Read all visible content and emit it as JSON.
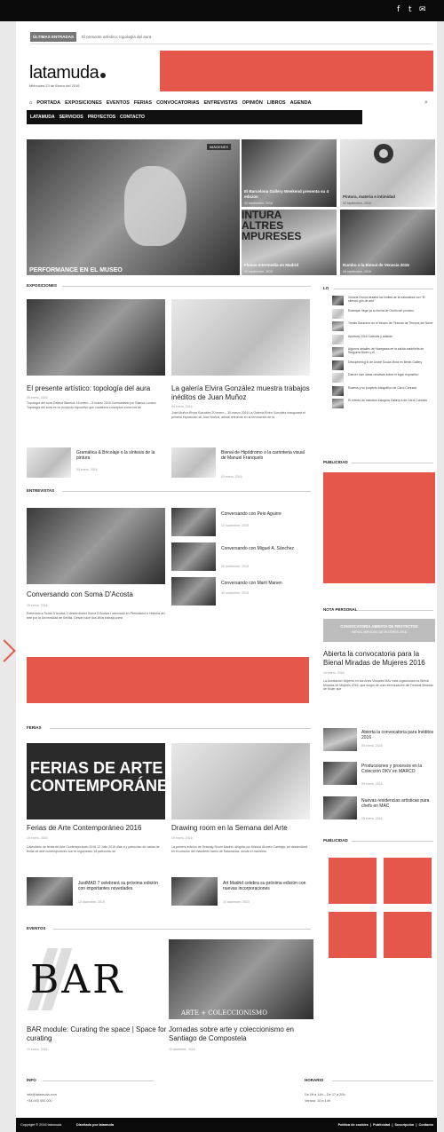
{
  "social": {
    "facebook": "f",
    "twitter": "t",
    "email": "✉"
  },
  "ticker": {
    "tag": "ÚLTIMAS ENTRADAS",
    "text": "El presente artístico: topología del aura"
  },
  "site": {
    "logo": "latamuda",
    "date": "Miércoles 23 de Enero del 2016"
  },
  "nav": {
    "primary": [
      "PORTADA",
      "EXPOSICIONES",
      "EVENTOS",
      "FERIAS",
      "CONVOCATORIAS",
      "ENTREVISTAS",
      "OPINIÓN",
      "LIBROS",
      "AGENDA"
    ],
    "secondary": [
      "LATAMUDA",
      "SERVICIOS",
      "PROYECTOS",
      "CONTACTO"
    ]
  },
  "hero": {
    "main": {
      "badge": "IMÁGENES",
      "caption": "PERFORMANCE EN EL MUSEO"
    },
    "tiles": [
      {
        "title": "El Barcelona Gallery Weekend presenta su 4 edición",
        "date": "30 septiembre, 2016"
      },
      {
        "title": "Fluxus Intermedia en Madrid",
        "date": "09 septiembre, 2016"
      },
      {
        "title": "Pintura, materia e intimidad",
        "date": "02 septiembre, 2016"
      },
      {
        "title": "Rumbo a la Bienal de Venecia 2015",
        "date": "06 septiembre, 2016"
      }
    ],
    "pintura_text": "INTURA\nALTRES\nMPURESES"
  },
  "sections": {
    "exposiciones": "EXPOSICIONES",
    "entrevistas": "ENTREVISTAS",
    "ferias": "FERIAS",
    "eventos": "EVENTOS"
  },
  "expo": {
    "a1": {
      "title": "El presente artístico: topología del aura",
      "date": "05 enero, 2016",
      "text": "Topología del aura Galería Bacelos 15 enero – 5 marzo 2016 Comisariado por Blanca Lozano. Topología del aura es un proyecto expositivo que cuestiona conceptos como los de"
    },
    "a2": {
      "title": "La galería Elvira González muestra trabajos inéditos de Juan Muñoz",
      "date": "04 enero, 2016",
      "text": "Juan Muñoz Elvira González 20 enero – 30 marzo 2016 La Galería Elvira González inaugurará el primera exposición de Juan Muñoz, artista referente en la renovación de la"
    },
    "s1": {
      "title": "Gramática & Bricolaje o la síntesis de la pintura",
      "date": "03 enero, 2016"
    },
    "s2": {
      "title": "Bienal de Hipódromo o la carrinteria visual de Manuel Franquelo",
      "date": "02 enero, 2016"
    }
  },
  "sidebar_list": {
    "title": "LO",
    "items": [
      "Victoria Civera desafía los límites de la naturaleza con \"El silencio gris de arte\"",
      "Estampa: llega ya su fecha de Otoño del próximo",
      "Tomás Saraceno en el Museo de Pinturas de Tempus del Norte",
      "Apertura 2016 Galerías y artistas",
      "Algunos detalles de Hasegawa en la salida madrileña de Rieguera Divert y el",
      "Desciphering lo de André Souza Mora en Berlin Gallery",
      "Dancer com ideas creativas sobre el lugar expositivo",
      "Rodeos y su proyecto fotográfico de Carol Conrado",
      "El evento de metodos inaugura Gallery a de Carol Conrado"
    ]
  },
  "publicidad": "PUBLICIDAD",
  "entrevistas": {
    "main": {
      "title": "Conversando con Soma D'Acosta",
      "date": "15 enero, 2016",
      "text": "Entrevista a Soma D'Acosta Y desarrollador Soma D'Acosta Licenciado en Periodismo e Historia del arte por la Universidad de Sevilla. Desde hace dos años trabaja como"
    },
    "items": [
      {
        "title": "Conversando con Peio Aguirre",
        "date": "12 noviembre, 2015"
      },
      {
        "title": "Conversando con Miguel A. Sánchez",
        "date": "20 noviembre, 2015"
      },
      {
        "title": "Conversando con Martí Manen",
        "date": "30 noviembre, 2015"
      }
    ]
  },
  "nota": {
    "label": "NOTA PERSONAL",
    "banner": "CONVOCATORIA ABIERTA DE PROYECTOS",
    "banner_sub": "BIENAL MIRADAS DE MUJERES 2016",
    "title": "Abierta la convocatoria para la Bienal Miradas de Mujeres 2016",
    "date": "10 enero, 2016",
    "text": "La Asociación Mujeres en las Artes Visuales MAV está organizando la Bienal Miradas de Mujeres 2016, que surgió de una reformulación del Festival Miradas de Mujer que",
    "items": [
      {
        "title": "Abierta la convocatoria para Inéditos 2016",
        "date": "09 enero, 2016"
      },
      {
        "title": "Producciones y procesos en la Colección DKV en MARCO",
        "date": "09 enero, 2016"
      },
      {
        "title": "Nuevas residencias artísticas para chefs en MAC",
        "date": "08 enero, 2016"
      }
    ]
  },
  "ferias": {
    "a1": {
      "img_text": "FERIAS DE ARTE\nCONTEMPORÁNE",
      "title": "Ferias de Arte Contemporáneo 2016",
      "date": "19 enero, 2016",
      "text": "Calendario de ferias de Arte Contemporáneo 2016 12 Julio 2016 días a y patrocinio de varias de ferias de arte contemporáneo con el organizado 16 patrocinio de"
    },
    "a2": {
      "title": "Drawing room en la Semana del Arte",
      "date": "19 enero, 2016",
      "text": "La primera edición de Drawing Room Madrid, dirigida por Mónica Álvarez Careaga, se desarrollará en el corazón del madrileño barrio de Salamanca, donde el momento"
    },
    "s1": {
      "title": "JustMAD 7 celebrará su próxima edición con importantes novedades",
      "date": "10 diciembre, 2015"
    },
    "s2": {
      "title": "Art Madrid celebra su próxima edición con nuevas incorporaciones",
      "date": "10 diciembre, 2015"
    }
  },
  "eventos": {
    "a1": {
      "img_text": "BAR",
      "title": "BAR module: Curating the space | Space for curating",
      "date": "10 enero, 2016"
    },
    "a2": {
      "img_text": "ARTE + COLECCIONISMO",
      "title": "Jornadas sobre arte y coleccionismo en Santiago de Compostela",
      "date": "10 diciembre, 2015"
    }
  },
  "footer": {
    "info": {
      "title": "INFO",
      "lines": [
        "info@latamuda.com",
        "+34 000 000 000"
      ]
    },
    "horario": {
      "title": "HORARIO",
      "lines": [
        "De 09 a 14h – De 17 a 20h",
        "Verano: 10 a 14h"
      ]
    },
    "copyright": "Copyright © 2016 latamuda",
    "designed": "Diseñado por latamuda",
    "links": "Política de cookies  |  Publicidad  |  Suscripción  |  Contacto"
  },
  "colors": {
    "accent": "#e4574a",
    "dark": "#0a0a0a"
  }
}
